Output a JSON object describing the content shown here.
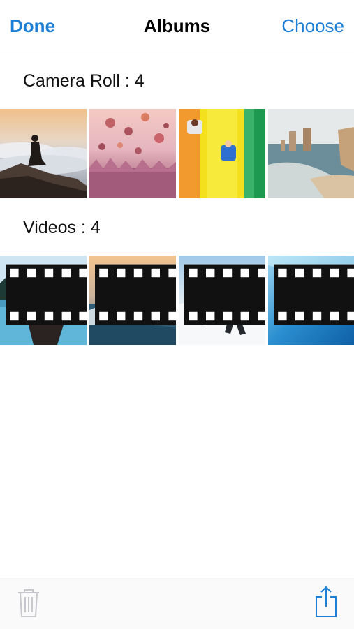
{
  "navbar": {
    "done_label": "Done",
    "title": "Albums",
    "choose_label": "Choose"
  },
  "sections": [
    {
      "title": "Camera Roll : 4",
      "items": [
        {
          "subject": "person sitting above clouds at sunset",
          "type": "photo"
        },
        {
          "subject": "bokeh over pink flower field",
          "type": "photo"
        },
        {
          "subject": "kids on yellow water slide",
          "type": "photo"
        },
        {
          "subject": "coastal rock stacks and beach",
          "type": "photo"
        }
      ]
    },
    {
      "title": "Videos : 4",
      "items": [
        {
          "subject": "woman in canoe on lake",
          "type": "video"
        },
        {
          "subject": "wave with rocky island at sunset",
          "type": "video"
        },
        {
          "subject": "surfers running into ocean",
          "type": "video"
        },
        {
          "subject": "underwater snorkeler",
          "type": "video"
        }
      ]
    }
  ],
  "toolbar": {
    "trash_icon": "trash-icon",
    "share_icon": "share-icon"
  },
  "colors": {
    "accent": "#1e7fd6",
    "disabled": "#c7c7cc"
  }
}
